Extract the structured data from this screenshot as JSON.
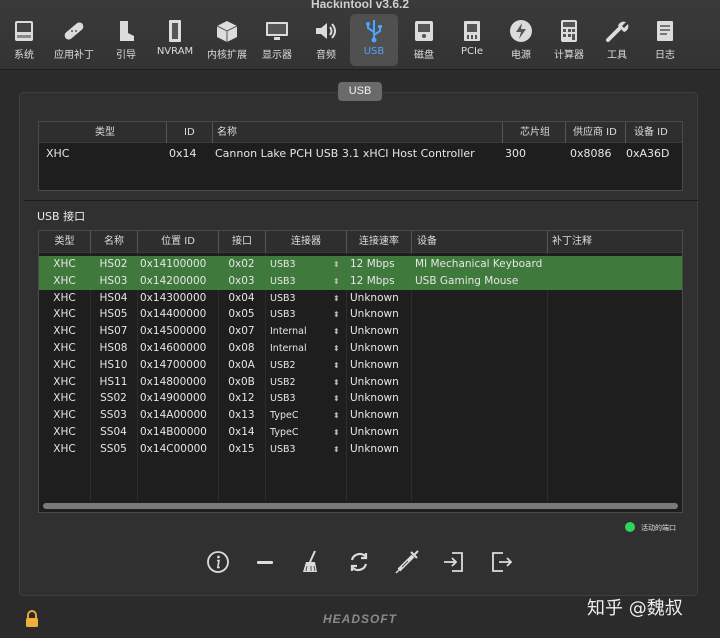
{
  "window": {
    "title": "Hackintool v3.6.2"
  },
  "toolbar": {
    "items": [
      {
        "label": "系统",
        "icon": "system-icon"
      },
      {
        "label": "应用补丁",
        "icon": "patch-icon"
      },
      {
        "label": "引导",
        "icon": "boot-icon"
      },
      {
        "label": "NVRAM",
        "icon": "nvram-icon"
      },
      {
        "label": "内核扩展",
        "icon": "kext-icon"
      },
      {
        "label": "显示器",
        "icon": "display-icon"
      },
      {
        "label": "音频",
        "icon": "audio-icon"
      },
      {
        "label": "USB",
        "icon": "usb-icon",
        "active": true
      },
      {
        "label": "磁盘",
        "icon": "disk-icon"
      },
      {
        "label": "PCIe",
        "icon": "pcie-icon"
      },
      {
        "label": "电源",
        "icon": "power-icon"
      },
      {
        "label": "计算器",
        "icon": "calculator-icon"
      },
      {
        "label": "工具",
        "icon": "tools-icon"
      },
      {
        "label": "日志",
        "icon": "log-icon"
      }
    ]
  },
  "segment": {
    "label": "USB"
  },
  "controllers": {
    "columns": [
      "类型",
      "ID",
      "名称",
      "芯片组",
      "供应商 ID",
      "设备 ID"
    ],
    "rows": [
      {
        "type": "XHC",
        "id": "0x14",
        "name": "Cannon Lake PCH USB 3.1 xHCI Host Controller",
        "chipset": "300",
        "vendor_id": "0x8086",
        "device_id": "0xA36D"
      }
    ]
  },
  "ports": {
    "section_label": "USB 接口",
    "columns": [
      "类型",
      "名称",
      "位置 ID",
      "接口",
      "连接器",
      "连接速率",
      "设备",
      "补丁注释"
    ],
    "rows": [
      {
        "type": "XHC",
        "name": "HS02",
        "location": "0x14100000",
        "port": "0x02",
        "connector": "USB3",
        "speed": "12 Mbps",
        "device": "MI Mechanical Keyboard",
        "comment": "",
        "active": true
      },
      {
        "type": "XHC",
        "name": "HS03",
        "location": "0x14200000",
        "port": "0x03",
        "connector": "USB3",
        "speed": "12 Mbps",
        "device": "USB Gaming Mouse",
        "comment": "",
        "active": true
      },
      {
        "type": "XHC",
        "name": "HS04",
        "location": "0x14300000",
        "port": "0x04",
        "connector": "USB3",
        "speed": "Unknown",
        "device": "",
        "comment": "",
        "active": false
      },
      {
        "type": "XHC",
        "name": "HS05",
        "location": "0x14400000",
        "port": "0x05",
        "connector": "USB3",
        "speed": "Unknown",
        "device": "",
        "comment": "",
        "active": false
      },
      {
        "type": "XHC",
        "name": "HS07",
        "location": "0x14500000",
        "port": "0x07",
        "connector": "Internal",
        "speed": "Unknown",
        "device": "",
        "comment": "",
        "active": false
      },
      {
        "type": "XHC",
        "name": "HS08",
        "location": "0x14600000",
        "port": "0x08",
        "connector": "Internal",
        "speed": "Unknown",
        "device": "",
        "comment": "",
        "active": false
      },
      {
        "type": "XHC",
        "name": "HS10",
        "location": "0x14700000",
        "port": "0x0A",
        "connector": "USB2",
        "speed": "Unknown",
        "device": "",
        "comment": "",
        "active": false
      },
      {
        "type": "XHC",
        "name": "HS11",
        "location": "0x14800000",
        "port": "0x0B",
        "connector": "USB2",
        "speed": "Unknown",
        "device": "",
        "comment": "",
        "active": false
      },
      {
        "type": "XHC",
        "name": "SS02",
        "location": "0x14900000",
        "port": "0x12",
        "connector": "USB3",
        "speed": "Unknown",
        "device": "",
        "comment": "",
        "active": false
      },
      {
        "type": "XHC",
        "name": "SS03",
        "location": "0x14A00000",
        "port": "0x13",
        "connector": "TypeC",
        "speed": "Unknown",
        "device": "",
        "comment": "",
        "active": false
      },
      {
        "type": "XHC",
        "name": "SS04",
        "location": "0x14B00000",
        "port": "0x14",
        "connector": "TypeC",
        "speed": "Unknown",
        "device": "",
        "comment": "",
        "active": false
      },
      {
        "type": "XHC",
        "name": "SS05",
        "location": "0x14C00000",
        "port": "0x15",
        "connector": "USB3",
        "speed": "Unknown",
        "device": "",
        "comment": "",
        "active": false
      }
    ]
  },
  "legend": {
    "label": "活动的端口",
    "color": "#32d35a"
  },
  "bottom_actions": [
    "info-icon",
    "remove-icon",
    "clear-icon",
    "refresh-icon",
    "inject-icon",
    "import-icon",
    "export-icon"
  ],
  "brand": "HEADSOFT",
  "watermark": "知乎 @魏叔",
  "colors": {
    "active_row": "#3f7a3c",
    "accent": "#4ea3ff"
  }
}
